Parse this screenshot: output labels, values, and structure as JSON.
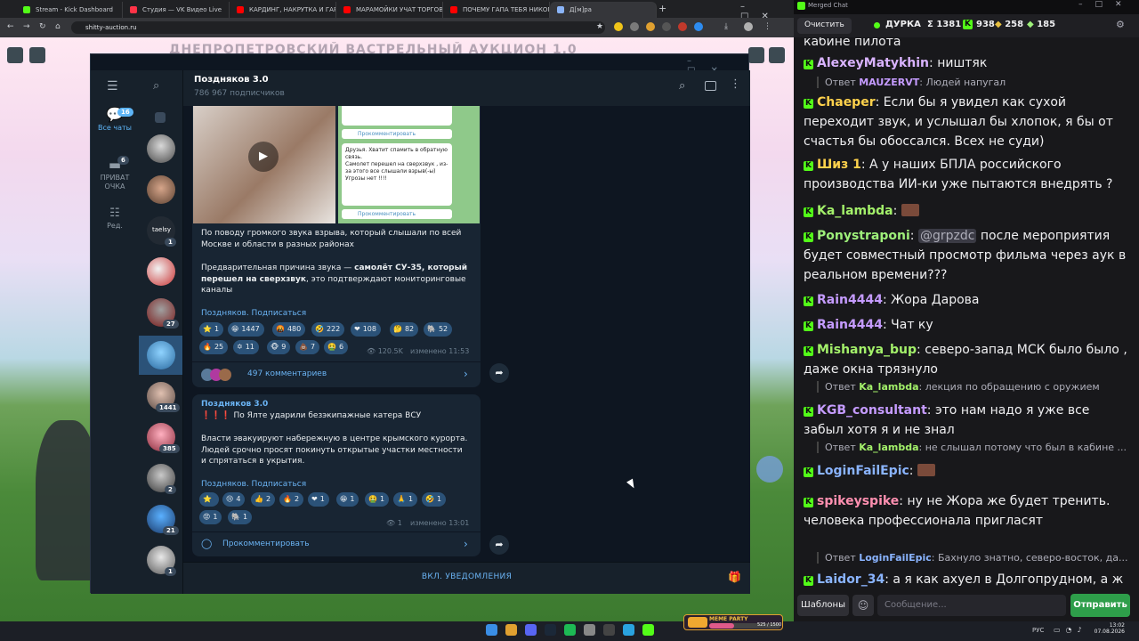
{
  "browser": {
    "tabs": [
      {
        "label": "Stream - Kick Dashboard",
        "color": "#53fc18"
      },
      {
        "label": "Студия — VK Видео Live",
        "color": "#ff3347"
      },
      {
        "label": "КАРДИНГ, НАКРУТКА И ГАРЕМ",
        "color": "#ff0000"
      },
      {
        "label": "МАРАМОЙКИ УЧАТ ТОРГОВАТЬ",
        "color": "#ff0000"
      },
      {
        "label": "ПОЧЕМУ ГАПА ТЕБЯ НИКОГДА",
        "color": "#ff0000"
      },
      {
        "label": "Д[м]ра",
        "color": "#8ab4f8"
      }
    ],
    "new_tab": "+",
    "url": "shitty-auction.ru"
  },
  "page": {
    "title": "ДНЕПРОПЕТРОВСКИЙ ВАСТРЕЛЬНЫЙ АУКЦИОН 1.0"
  },
  "telegram": {
    "rail": [
      {
        "label": "Все чаты",
        "badge": "16"
      },
      {
        "label": "ПРИВАТ\nОЧКА",
        "badge": "6"
      },
      {
        "label": "Ред."
      }
    ],
    "chat_badges": {
      "c4": "1",
      "c6": "27",
      "c8": "1441",
      "c9": "385",
      "c10": "2",
      "c11": "21",
      "c12": "1"
    },
    "list_label_c4": "taelsy",
    "channel_name": "Поздняков 3.0",
    "subscribers": "786 967 подписчиков",
    "post1": {
      "thumb_caption_1": "Друзья. Хватит спамить в обратную связь.",
      "thumb_caption_2": "Самолет перешел на сверхзвук , из-за этого все слышали взрыв(-ы) Угрозы нет !!!!",
      "thumb_comment_1": "Прокомментировать",
      "thumb_comment_2": "Прокомментировать",
      "text1": "По поводу громкого звука взрыва, который слышали по всей Москве и области в разных районах",
      "text2_pre": "Предварительная причина звука — ",
      "text2_bold": "самолёт СУ-35, который перешел на сверхзвук",
      "text2_post": ", это подтверждают мониторинговые каналы",
      "subscribe": "Поздняков. Подписаться",
      "reactions_row1": [
        {
          "e": "⭐",
          "n": "1"
        },
        {
          "e": "😁",
          "n": "1447"
        },
        {
          "e": "🤬",
          "n": "480"
        },
        {
          "e": "🤣",
          "n": "222"
        },
        {
          "e": "❤",
          "n": "108"
        },
        {
          "e": "🤔",
          "n": "82"
        },
        {
          "e": "🐘",
          "n": "52"
        }
      ],
      "reactions_row2": [
        {
          "e": "🔥",
          "n": "25"
        },
        {
          "e": "✡",
          "n": "11"
        },
        {
          "e": "🐵",
          "n": "9"
        },
        {
          "e": "💩",
          "n": "7"
        },
        {
          "e": "🤮",
          "n": "6"
        }
      ],
      "views": "120.5K",
      "edited": "изменено 11:53",
      "comments": "497 комментариев"
    },
    "post2": {
      "author": "Поздняков 3.0",
      "headline_marks": "❗❗❗",
      "headline": "По Ялте ударили безэкипажные катера ВСУ",
      "text": "Власти эвакуируют набережную в центре крымского курорта. Людей срочно просят покинуть открытые участки местности и спрятаться в укрытия.",
      "subscribe": "Поздняков. Подписаться",
      "reactions_row1": [
        {
          "e": "⭐",
          "n": ""
        },
        {
          "e": "😢",
          "n": "4"
        },
        {
          "e": "👍",
          "n": "2"
        },
        {
          "e": "🔥",
          "n": "2"
        },
        {
          "e": "❤",
          "n": "1"
        },
        {
          "e": "😁",
          "n": "1"
        },
        {
          "e": "🤮",
          "n": "1"
        },
        {
          "e": "🙏",
          "n": "1"
        },
        {
          "e": "🤣",
          "n": "1"
        }
      ],
      "reactions_row2": [
        {
          "e": "😡",
          "n": "1"
        },
        {
          "e": "🐘",
          "n": "1"
        }
      ],
      "views": "1",
      "edited": "изменено 13:01",
      "comment_btn": "Прокомментировать"
    },
    "bottom": "ВКЛ. УВЕДОМЛЕНИЯ"
  },
  "chat": {
    "window_title": "Merged Chat",
    "clear_btn": "Очистить",
    "streamer": "ДУРКА",
    "stats": [
      {
        "icon": "Σ",
        "n": "1381"
      },
      {
        "icon": "K",
        "n": "938"
      },
      {
        "icon": "VK",
        "n": "258"
      },
      {
        "icon": "R",
        "n": "185"
      }
    ],
    "messages": [
      {
        "type": "cont",
        "text": "кабине пилота"
      },
      {
        "type": "msg",
        "user": "AlexeyMatykhin",
        "color": "#d9b3ff",
        "text": "ништяк"
      },
      {
        "type": "reply",
        "prefix": "Ответ",
        "user": "MAUZERVT",
        "ucolor": "#c59bff",
        "text": "Людей напугал"
      },
      {
        "type": "msg",
        "user": "Chaeper",
        "color": "#ffd24c",
        "text": "Если бы я увидел как сухой переходит звук, и услышал бы хлопок, я бы от счастья бы обоссался. Всех не суди)"
      },
      {
        "type": "msg",
        "user": "Шиз 1",
        "color": "#ffd24c",
        "text": "А у наших БПЛА российского производства ИИ-ки уже пытаются внедрять ?"
      },
      {
        "type": "msg",
        "user": "Ka_lambda",
        "color": "#a3f06a",
        "text": ""
      },
      {
        "type": "msg",
        "user": "Ponystraponi",
        "color": "#9ef07a",
        "mention": "@grpzdc",
        "text": "после мероприятия будет совместный просмотр фильма через аук в реальном времени???"
      },
      {
        "type": "msg",
        "user": "Rain4444",
        "color": "#c59bff",
        "text": "Жора Дарова"
      },
      {
        "type": "msg",
        "user": "Rain4444",
        "color": "#c59bff",
        "text": "Чат ку"
      },
      {
        "type": "msg",
        "user": "Mishanya_bup",
        "color": "#a3f06a",
        "text": "северо-запад МСК было было , даже окна трязнуло"
      },
      {
        "type": "reply",
        "prefix": "Ответ",
        "user": "Ka_lambda",
        "ucolor": "#a3f06a",
        "text": "лекция по обращению с оружием"
      },
      {
        "type": "msg",
        "user": "KGB_consultant",
        "color": "#c59bff",
        "text": "это нам надо я уже все забыл хотя я и не знал"
      },
      {
        "type": "reply",
        "prefix": "Ответ",
        "user": "Ka_lambda",
        "ucolor": "#a3f06a",
        "text": "не слышал потому что был в кабине ..."
      },
      {
        "type": "msg",
        "user": "LoginFailEpic",
        "color": "#8ab4ff",
        "text": ""
      },
      {
        "type": "msg",
        "user": "spikeyspike",
        "color": "#ff8fb0",
        "text": "ну не Жора же будет тренить. человека профессионала пригласят"
      },
      {
        "type": "reply",
        "prefix": "Ответ",
        "user": "LoginFailEpic",
        "ucolor": "#8ab4ff",
        "text": "Бахнуло знатно, северо-восток, да..."
      },
      {
        "type": "msg",
        "user": "Laidor_34",
        "color": "#8ab4ff",
        "text": "а я как ахуел в Долгопрудном, а ж в Раду зашел)"
      }
    ],
    "templates_btn": "Шаблоны",
    "input_placeholder": "Сообщение...",
    "send_btn": "Отправить"
  },
  "taskbar": {
    "widget_title": "MEME PARTY",
    "widget_progress": "525 / 1500",
    "lang": "РУС",
    "time": "13:02",
    "date": "07.08.2026"
  }
}
